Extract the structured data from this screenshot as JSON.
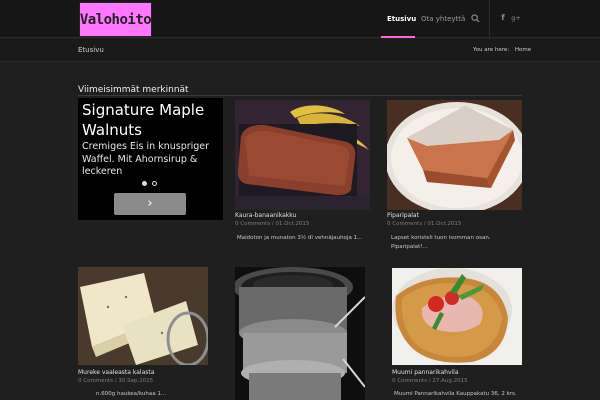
{
  "header": {
    "logo_text": "Valohoito",
    "nav": [
      {
        "label": "Etusivu",
        "active": true
      },
      {
        "label": "Ota yhteyttä",
        "active": false
      }
    ],
    "icons": [
      "search-icon",
      "facebook-icon",
      "google-plus-icon"
    ],
    "accent": "#ff66dd",
    "logo_bg": "#ff77ff"
  },
  "subbar": {
    "title": "Etusivu",
    "breadcrumb_prefix": "You are here:",
    "breadcrumb_home": "Home"
  },
  "section": {
    "title": "Viimeisimmät merkinnät"
  },
  "ad": {
    "headline": "Signature Maple Walnuts",
    "body": "Cremiges Eis in knuspriger Waffel. Mit Ahornsirup & leckeren",
    "button_glyph": "›",
    "dots": 2,
    "active_dot": 1
  },
  "posts": [
    {
      "title": "Kaura-banaanikakku",
      "meta": "0 Comments / 01.Oct.2015",
      "excerpt": "Maidoton ja munaton   3½ dl vehnäjauhoja 1..."
    },
    {
      "title": "Piparipalat",
      "meta": "0 Comments / 01.Oct.2015",
      "excerpt": "Lapset koristeli tuon isomman osan. Piparipalat!..."
    },
    {
      "title": "Mureke vaaleasta kalasta",
      "meta": "0 Comments / 30.Sep.2015",
      "excerpt": "n.600g haukea/kuhaa 1..."
    },
    {
      "title": "Muumi pannarikahvila",
      "meta": "0 Comments / 27.Aug.2015",
      "excerpt": "Muumi Pannarikahvila Kauppakatu 36, 2 krs."
    }
  ]
}
